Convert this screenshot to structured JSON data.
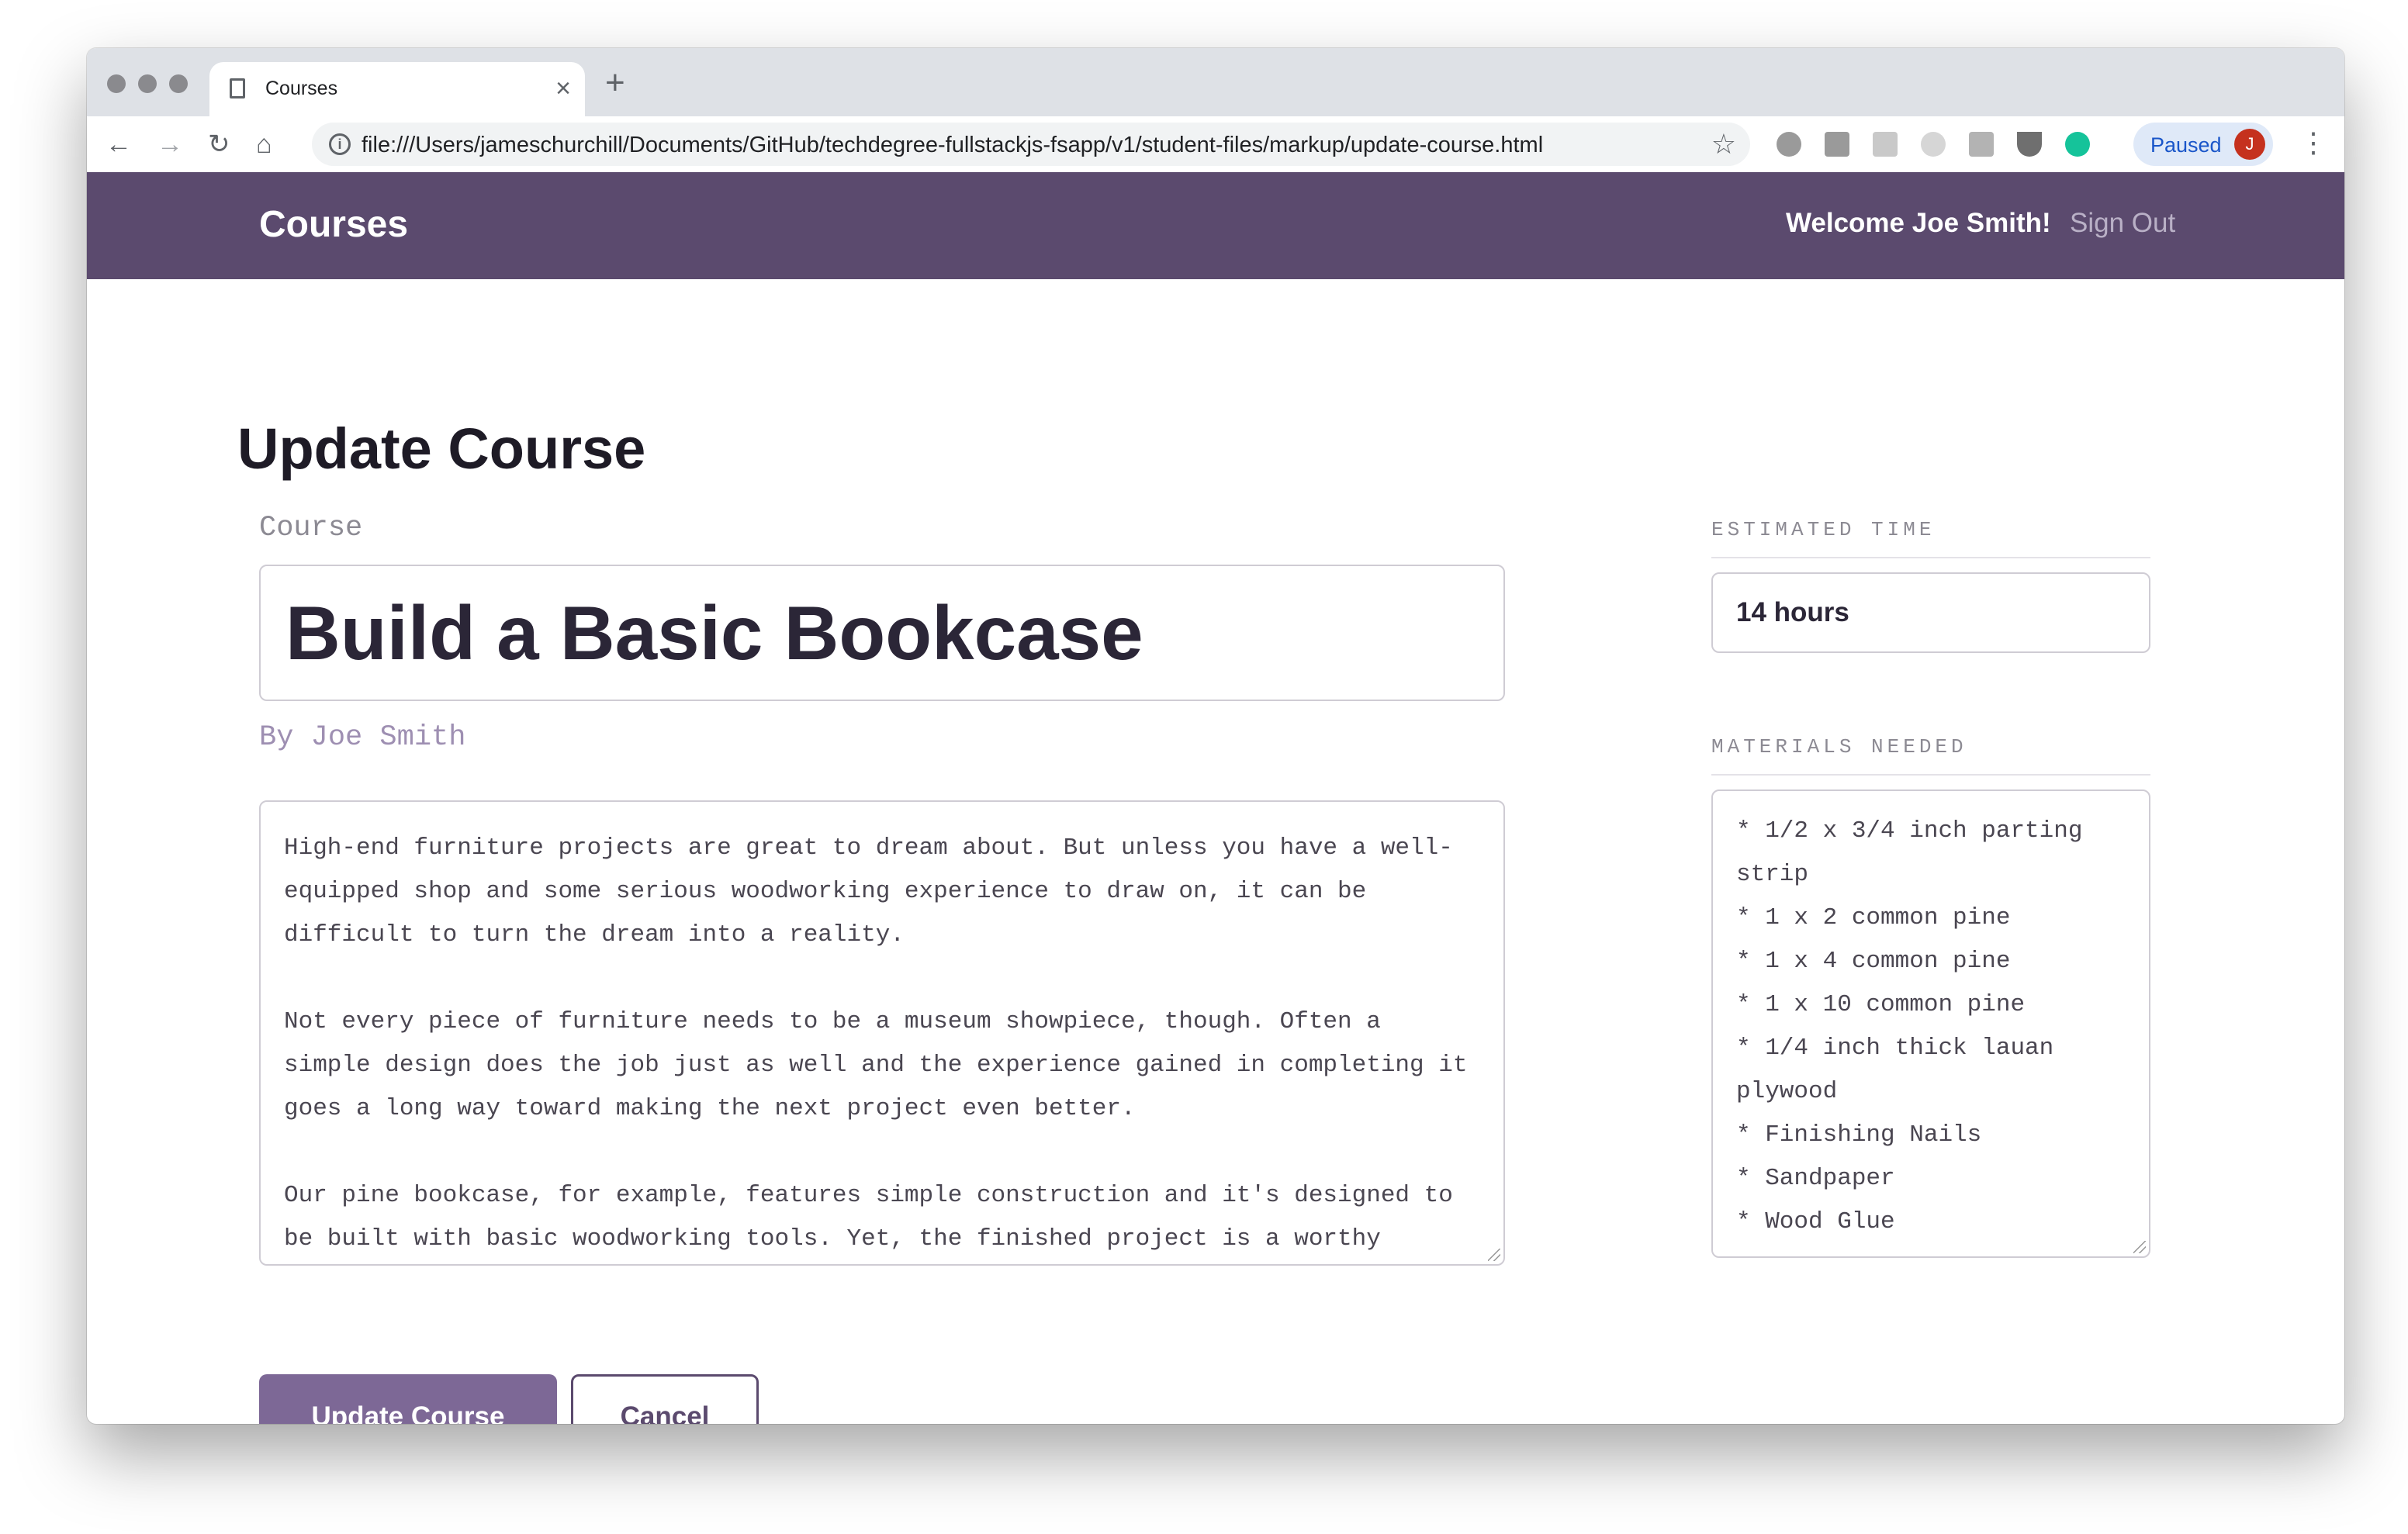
{
  "browser": {
    "tab_title": "Courses",
    "new_tab_symbol": "+",
    "close_symbol": "×",
    "url": "file:///Users/jameschurchill/Documents/GitHub/techdegree-fullstackjs-fsapp/v1/student-files/markup/update-course.html",
    "profile_status": "Paused",
    "profile_initial": "J",
    "icons": [
      "back-icon",
      "forward-icon",
      "reload-icon",
      "home-icon",
      "info-icon",
      "star-icon",
      "menu-icon"
    ]
  },
  "header": {
    "brand": "Courses",
    "welcome": "Welcome Joe Smith!",
    "sign_out": "Sign Out"
  },
  "page": {
    "title": "Update Course",
    "course_label": "Course",
    "course_title": "Build a Basic Bookcase",
    "byline": "By Joe Smith",
    "description": [
      "High-end furniture projects are great to dream about. But unless you have a well-equipped shop and some serious woodworking experience to draw on, it can be difficult to turn the dream into a reality.",
      "Not every piece of furniture needs to be a museum showpiece, though. Often a simple design does the job just as well and the experience gained in completing it goes a long way toward making the next project even better.",
      "Our pine bookcase, for example, features simple construction and it's designed to be built with basic woodworking tools. Yet, the finished project is a worthy"
    ],
    "estimated_time_label": "ESTIMATED TIME",
    "estimated_time": "14 hours",
    "materials_label": "MATERIALS NEEDED",
    "materials": [
      "* 1/2 x 3/4 inch parting",
      "strip",
      "* 1 x 2 common pine",
      "* 1 x 4 common pine",
      "* 1 x 10 common pine",
      "* 1/4 inch thick lauan",
      "plywood",
      "* Finishing Nails",
      "* Sandpaper",
      "* Wood Glue"
    ],
    "update_button": "Update Course",
    "cancel_button": "Cancel"
  },
  "colors": {
    "header_bg": "#5b4a6e",
    "primary_button": "#7d6896",
    "accent_text": "#9e8fb2"
  }
}
